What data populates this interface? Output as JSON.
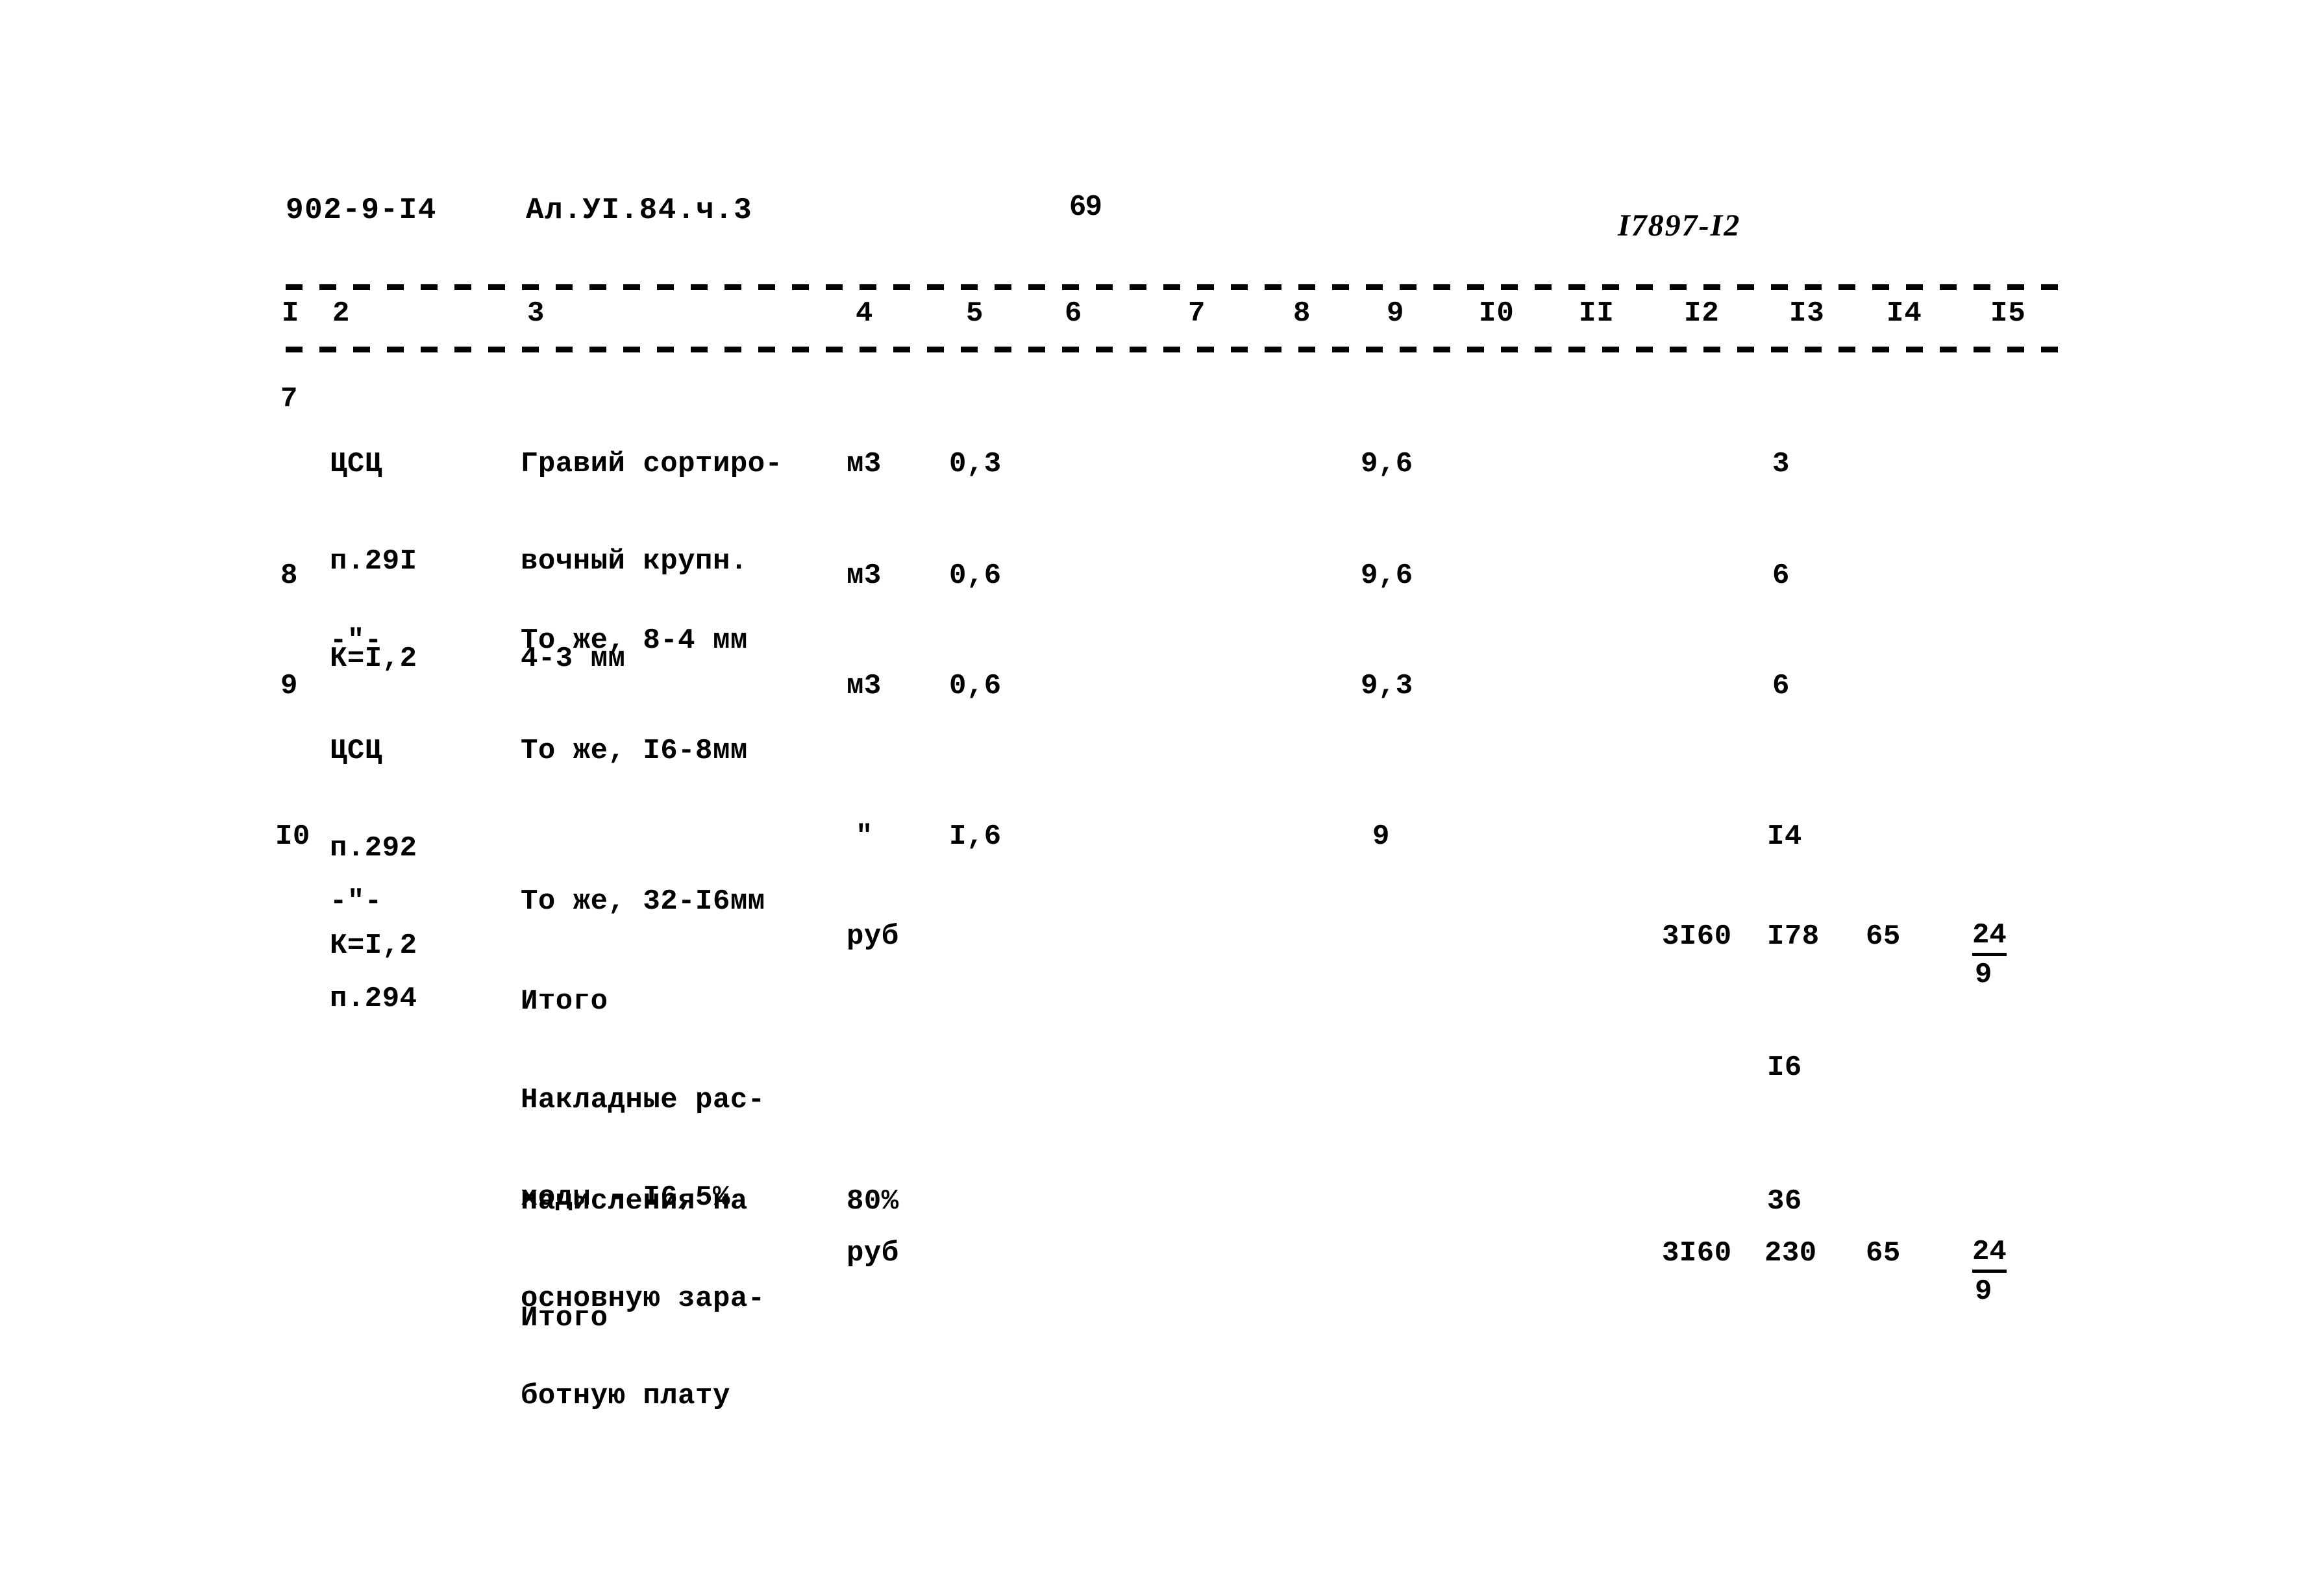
{
  "header": {
    "doc_code": "902-9-I4",
    "album_ref": "Ал.УI.84.ч.3",
    "page_number": "69",
    "archive_stamp": "I7897-I2"
  },
  "table": {
    "column_headers": [
      "I",
      "2",
      "3",
      "4",
      "5",
      "6",
      "7",
      "8",
      "9",
      "I0",
      "II",
      "I2",
      "I3",
      "I4",
      "I5"
    ],
    "rows": [
      {
        "num": "7",
        "ref_line1": "ЦСЦ",
        "ref_line2": "п.29I",
        "ref_line3": "К=I,2",
        "desc_line1": "Гравий сортиро-",
        "desc_line2": "вочный крупн.",
        "desc_line3": "4-3 мм",
        "unit": "м3",
        "qty": "0,3",
        "col9": "9,6",
        "col13": "3"
      },
      {
        "num": "8",
        "ref_line1": "-\"-",
        "ref_line2": "",
        "ref_line3": "",
        "desc_line1": "То же, 8-4 мм",
        "desc_line2": "",
        "desc_line3": "",
        "unit": "м3",
        "qty": "0,6",
        "col9": "9,6",
        "col13": "6"
      },
      {
        "num": "9",
        "ref_line1": "ЦСЦ",
        "ref_line2": "п.292",
        "ref_line3": "К=I,2",
        "desc_line1": "То же, I6-8мм",
        "desc_line2": "",
        "desc_line3": "",
        "unit": "м3",
        "qty": "0,6",
        "col9": "9,3",
        "col13": "6"
      },
      {
        "num": "I0",
        "ref_line1": "-\"-",
        "ref_line2": "п.294",
        "ref_line3": "",
        "desc_line1": "То же, 32-I6мм",
        "desc_line2": "",
        "desc_line3": "",
        "unit": "\"",
        "qty": "I,6",
        "col9": "9",
        "col13": "I4"
      }
    ],
    "summary_rows": [
      {
        "label_line1": "Итого",
        "label_line2": "",
        "label_line3": "",
        "unit": "руб",
        "col12": "3I60",
        "col13": "I78",
        "col14": "65",
        "col15_top": "24",
        "col15_bot": "9"
      },
      {
        "label_line1": "Накладные рас-",
        "label_line2": "ходы - I6,5%",
        "label_line3": "",
        "unit": "",
        "col12": "",
        "col13": "I6",
        "col14": "",
        "col15_top": "",
        "col15_bot": ""
      },
      {
        "label_line1": "Начисления на",
        "label_line2": "основную зара-",
        "label_line3": "ботную плату",
        "unit": "80%",
        "col12": "",
        "col13": "36",
        "col14": "",
        "col15_top": "",
        "col15_bot": ""
      },
      {
        "label_line1": "Итого",
        "label_line2": "",
        "label_line3": "",
        "unit": "руб",
        "col12": "3I60",
        "col13": "230",
        "col14": "65",
        "col15_top": "24",
        "col15_bot": "9"
      }
    ]
  }
}
